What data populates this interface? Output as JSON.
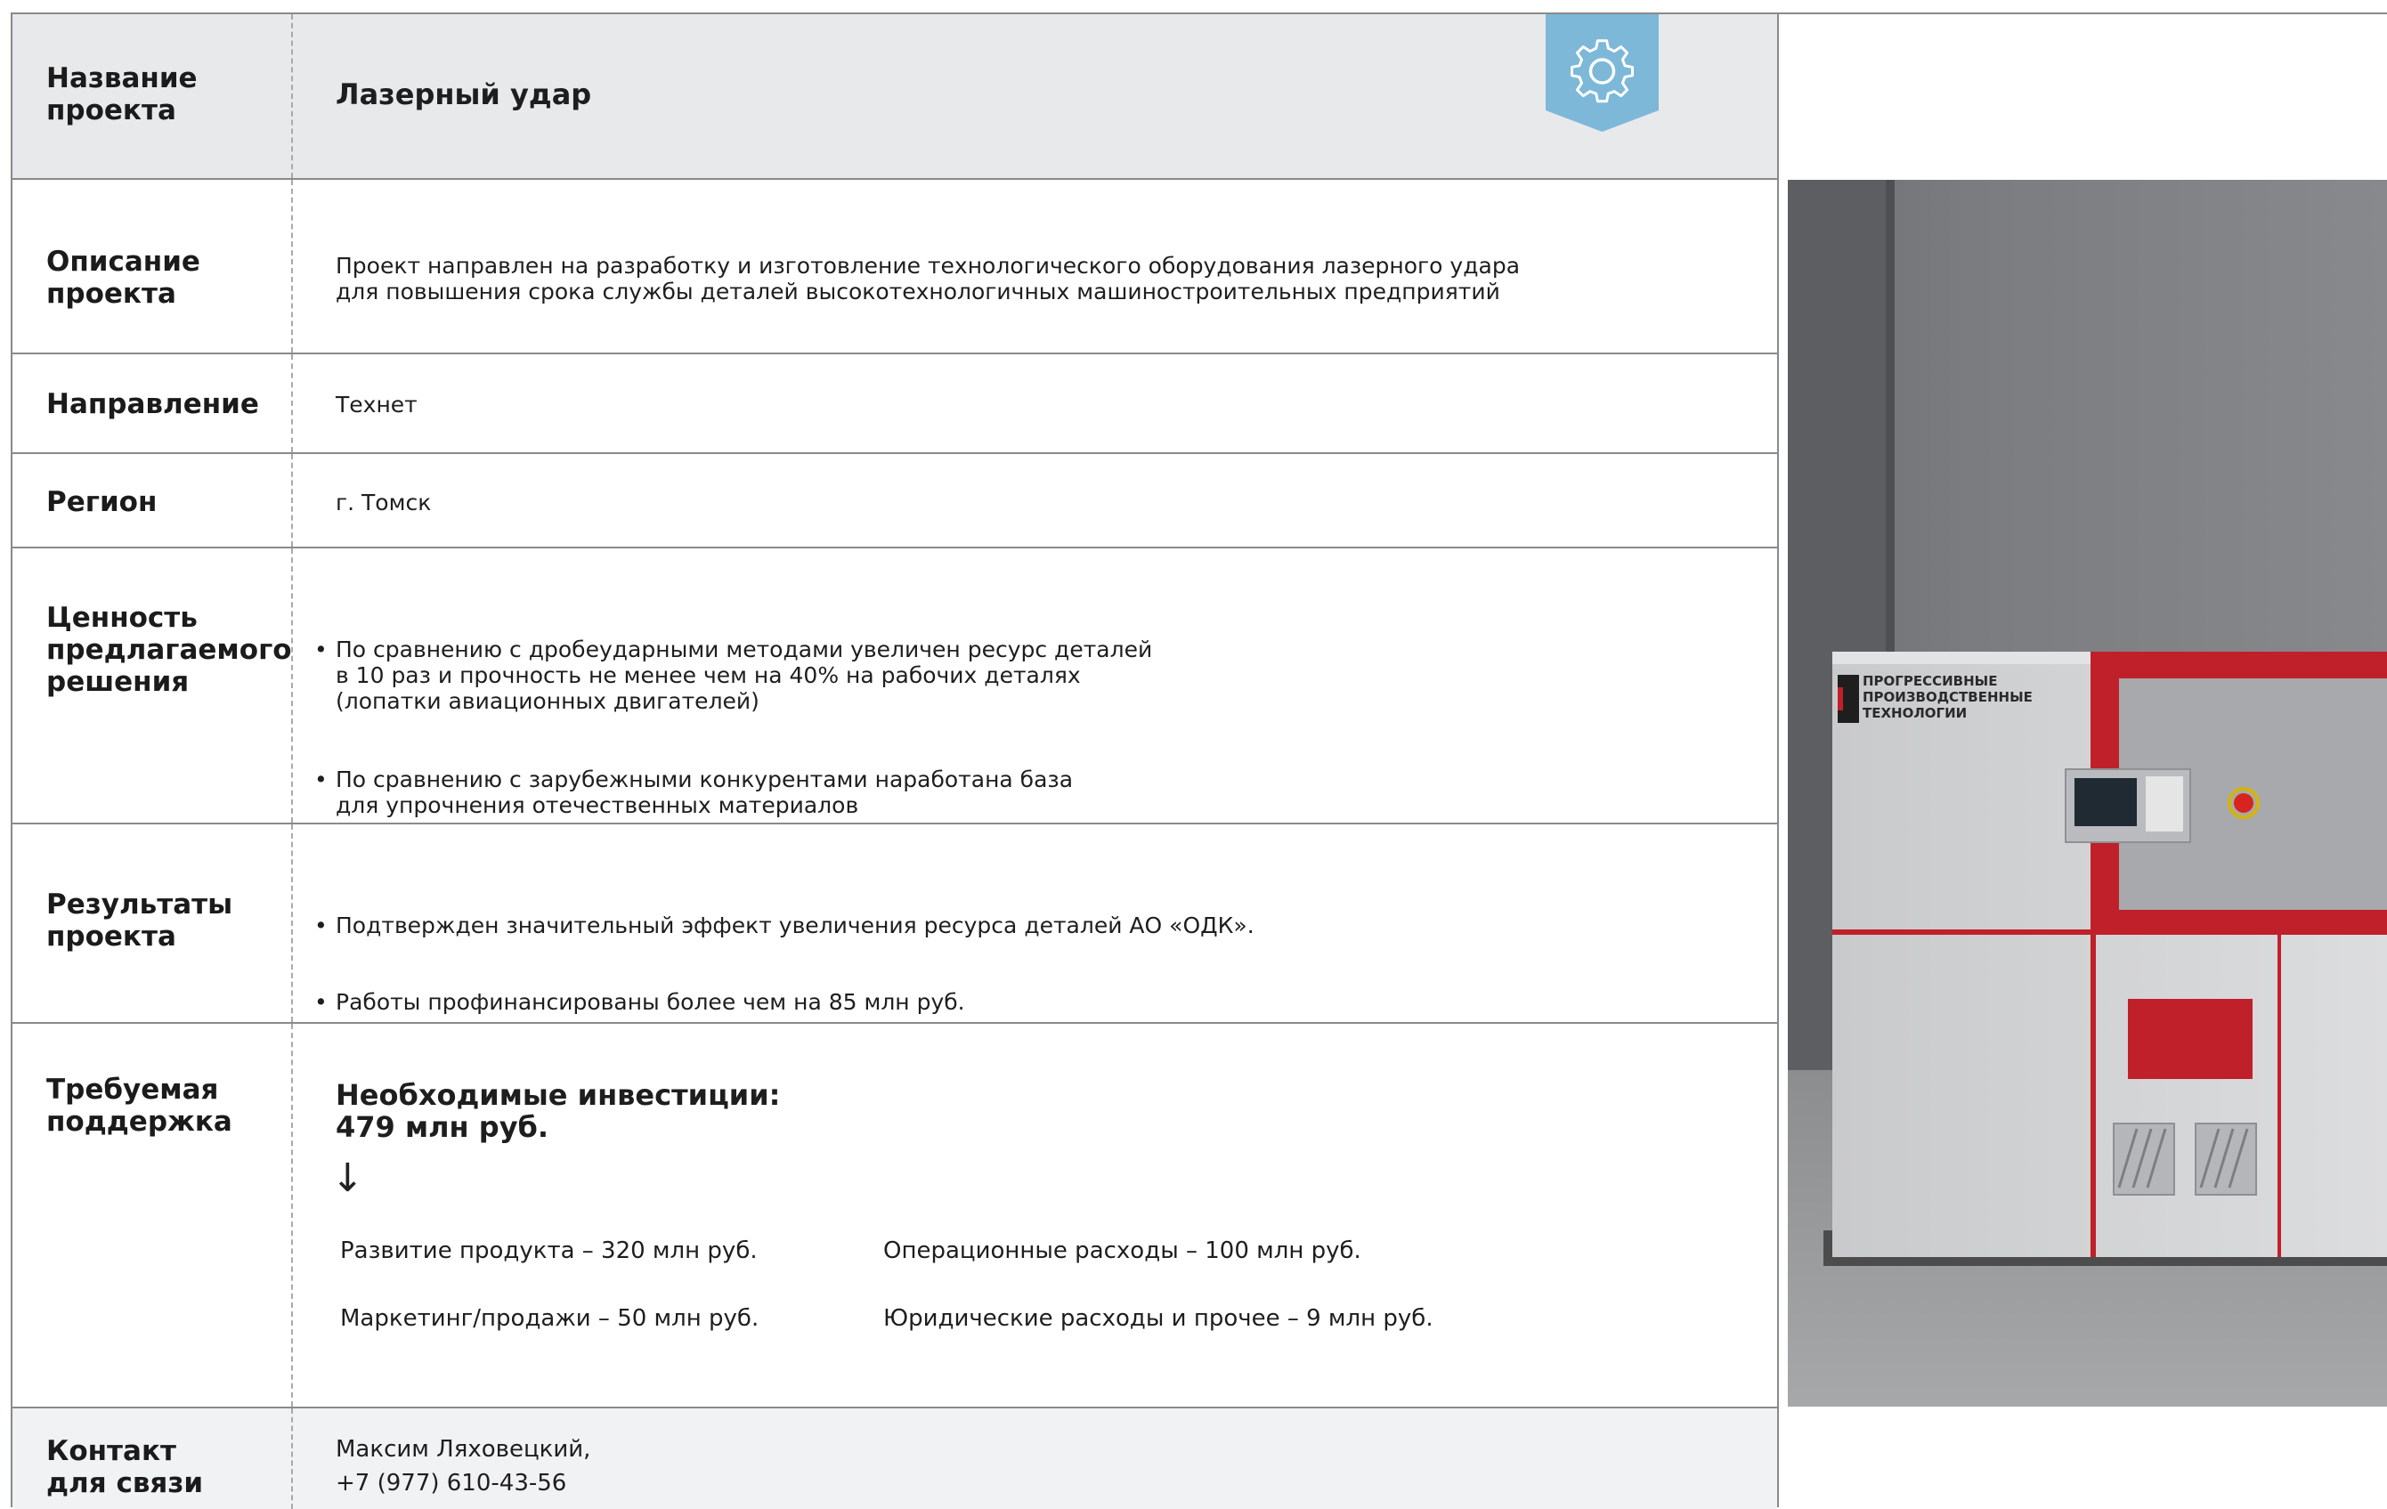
{
  "project_name": {
    "label": "Название\nпроекта",
    "value": "Лазерный удар"
  },
  "description": {
    "label": "Описание\nпроекта",
    "value": "Проект направлен на разработку и изготовление технологического оборудования лазерного удара\nдля повышения срока службы деталей высокотехнологичных машиностроительных предприятий"
  },
  "direction": {
    "label": "Направление",
    "value": "Технет"
  },
  "region": {
    "label": "Регион",
    "value": "г. Томск"
  },
  "value_prop": {
    "label": "Ценность\nпредлагаемого\nрешения",
    "items": [
      "По сравнению с дробеударными методами увеличен ресурс деталей\nв 10 раз и прочность не менее чем на 40% на рабочих деталях\n(лопатки авиационных двигателей)",
      "По сравнению с зарубежными конкурентами наработана база\nдля упрочнения отечественных материалов"
    ]
  },
  "results": {
    "label": "Результаты\nпроекта",
    "items": [
      "Подтвержден значительный эффект увеличения ресурса деталей АО «ОДК».",
      "Работы профинансированы более чем на 85 млн руб."
    ]
  },
  "support": {
    "label": "Требуемая\nподдержка",
    "investment": "Необходимые инвестиции:\n479 млн руб.",
    "arrow": "↓",
    "allocations": [
      "Развитие продукта – 320 млн руб.",
      "Операционные расходы – 100 млн руб.",
      "Маркетинг/продажи – 50 млн руб.",
      "Юридические расходы и прочее – 9 млн руб."
    ]
  },
  "contact": {
    "label": "Контакт\nдля связи",
    "name": "Максим Ляховецкий,",
    "phone": "+7 (977) 610-43-56"
  },
  "photo": {
    "logo_lines": [
      "ПРОГРЕССИВНЫЕ",
      "ПРОИЗВОДСТВЕННЫЕ",
      "ТЕХНОЛОГИИ"
    ],
    "accent_red": "#c0202a"
  },
  "badge": {
    "icon": "gear-icon",
    "color": "#7db8d8"
  }
}
